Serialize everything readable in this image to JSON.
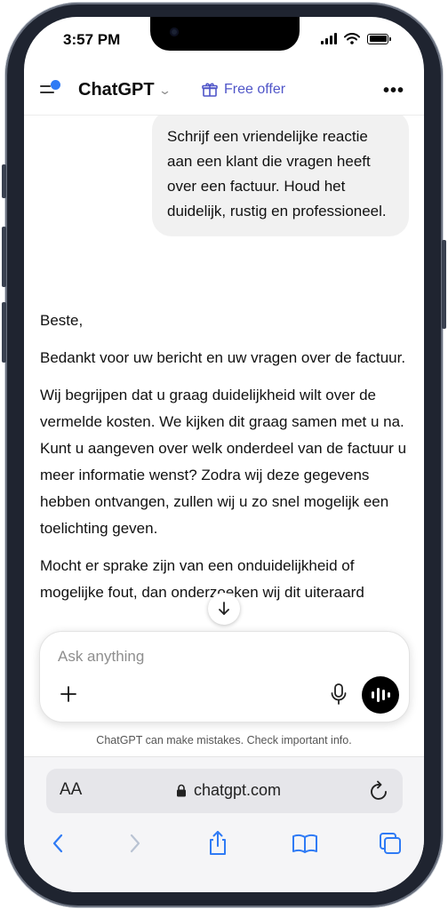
{
  "status_bar": {
    "time": "3:57 PM"
  },
  "header": {
    "title": "ChatGPT",
    "free_offer_label": "Free offer",
    "more_label": "•••"
  },
  "conversation": {
    "user_message": "Schrijf een vriendelijke reactie aan een klant die vragen heeft over een factuur. Houd het duidelijk, rustig en professioneel.",
    "assistant_paragraphs": [
      "Beste,",
      "Bedankt voor uw bericht en uw vragen over de factuur.",
      "Wij begrijpen dat u graag duidelijkheid wilt over de vermelde kosten. We kijken dit graag samen met u na. Kunt u aangeven over welk onderdeel van de factuur u meer informatie wenst? Zodra wij deze gegevens hebben ontvangen, zullen wij u zo snel mogelijk een toelichting geven.",
      "Mocht er sprake zijn van een onduidelijkheid of mogelijke fout, dan onderzoeken wij dit uiteraard"
    ]
  },
  "composer": {
    "placeholder": "Ask anything",
    "value": ""
  },
  "disclaimer": "ChatGPT can make mistakes. Check important info.",
  "safari": {
    "aa_label": "AA",
    "url": "chatgpt.com"
  },
  "colors": {
    "accent": "#2f7bf5",
    "free_offer": "#4f55c8",
    "user_bubble": "#f1f1f1",
    "safari_blue": "#2f7bf5"
  }
}
